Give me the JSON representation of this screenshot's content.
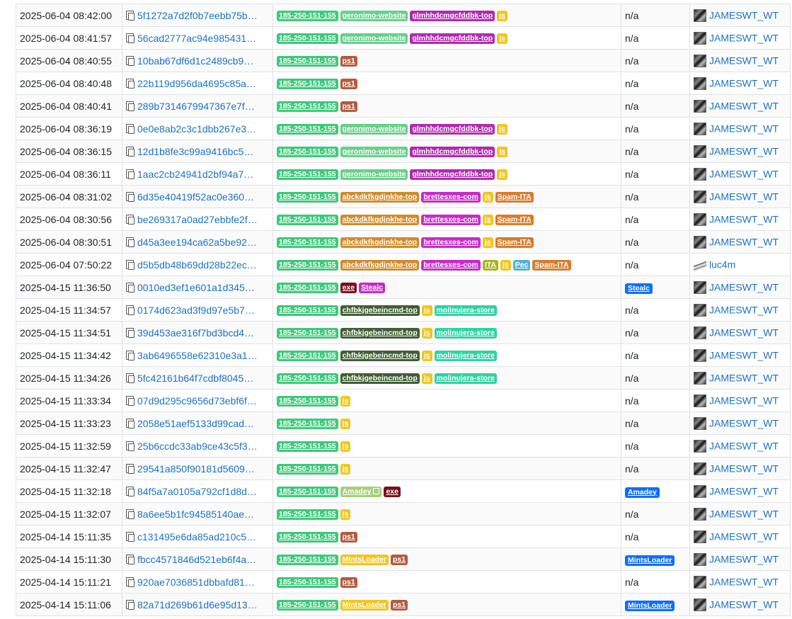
{
  "colors": {
    "185-250-151-155": "#3cc97a",
    "geronimo-website": "#66d089",
    "glmhhdcmgcfddbk-top": "#b02ab0",
    "js": "#f2c51c",
    "ps1": "#b35a3f",
    "abckdkfkgdjnkhe-top": "#d08c2a",
    "brettesxes-com": "#c82ac8",
    "Spam-ITA": "#d97b2a",
    "ITA": "#a8b41c",
    "Pec": "#4cb7d6",
    "exe": "#7a0f1e",
    "Stealc": "#c42ac8",
    "chfbkjgebeincmd-top": "#3f5e34",
    "molinujera-store": "#2fd3a2",
    "Amadey": "#a4d07a",
    "MintsLoader": "#f2c51c"
  },
  "rows": [
    {
      "date": "2025-06-04 08:42:00",
      "hash": "5f1272a7d2f0b7eebb75b…",
      "tags": [
        "185-250-151-155",
        "geronimo-website",
        "glmhhdcmgcfddbk-top",
        "js"
      ],
      "signature": "n/a",
      "reporter": "JAMESWT_WT"
    },
    {
      "date": "2025-06-04 08:41:57",
      "hash": "56cad2777ac94e9854316…",
      "tags": [
        "185-250-151-155",
        "geronimo-website",
        "glmhhdcmgcfddbk-top",
        "js"
      ],
      "signature": "n/a",
      "reporter": "JAMESWT_WT"
    },
    {
      "date": "2025-06-04 08:40:55",
      "hash": "10bab67df6d1c2489cb9…",
      "tags": [
        "185-250-151-155",
        "ps1"
      ],
      "signature": "n/a",
      "reporter": "JAMESWT_WT"
    },
    {
      "date": "2025-06-04 08:40:48",
      "hash": "22b119d956da4695c85a…",
      "tags": [
        "185-250-151-155",
        "ps1"
      ],
      "signature": "n/a",
      "reporter": "JAMESWT_WT"
    },
    {
      "date": "2025-06-04 08:40:41",
      "hash": "289b7314679947367e7fc…",
      "tags": [
        "185-250-151-155",
        "ps1"
      ],
      "signature": "n/a",
      "reporter": "JAMESWT_WT"
    },
    {
      "date": "2025-06-04 08:36:19",
      "hash": "0e0e8ab2c3c1dbb267e3…",
      "tags": [
        "185-250-151-155",
        "geronimo-website",
        "glmhhdcmgcfddbk-top",
        "js"
      ],
      "signature": "n/a",
      "reporter": "JAMESWT_WT"
    },
    {
      "date": "2025-06-04 08:36:15",
      "hash": "12d1b8fe3c99a9416bc53…",
      "tags": [
        "185-250-151-155",
        "geronimo-website",
        "glmhhdcmgcfddbk-top",
        "js"
      ],
      "signature": "n/a",
      "reporter": "JAMESWT_WT"
    },
    {
      "date": "2025-06-04 08:36:11",
      "hash": "1aac2cb24941d2bf94a70…",
      "tags": [
        "185-250-151-155",
        "geronimo-website",
        "glmhhdcmgcfddbk-top",
        "js"
      ],
      "signature": "n/a",
      "reporter": "JAMESWT_WT"
    },
    {
      "date": "2025-06-04 08:31:02",
      "hash": "6d35e40419f52ac0e3603…",
      "tags": [
        "185-250-151-155",
        "abckdkfkgdjnkhe-top",
        "brettesxes-com",
        "js",
        "Spam-ITA"
      ],
      "signature": "n/a",
      "reporter": "JAMESWT_WT"
    },
    {
      "date": "2025-06-04 08:30:56",
      "hash": "be269317a0ad27ebbfe2f…",
      "tags": [
        "185-250-151-155",
        "abckdkfkgdjnkhe-top",
        "brettesxes-com",
        "js",
        "Spam-ITA"
      ],
      "signature": "n/a",
      "reporter": "JAMESWT_WT"
    },
    {
      "date": "2025-06-04 08:30:51",
      "hash": "d45a3ee194ca62a5be92…",
      "tags": [
        "185-250-151-155",
        "abckdkfkgdjnkhe-top",
        "brettesxes-com",
        "js",
        "Spam-ITA"
      ],
      "signature": "n/a",
      "reporter": "JAMESWT_WT"
    },
    {
      "date": "2025-06-04 07:50:22",
      "hash": "d5b5db48b69dd28b22ec…",
      "tags": [
        "185-250-151-155",
        "abckdkfkgdjnkhe-top",
        "brettesxes-com",
        "ITA",
        "js",
        "Pec",
        "Spam-ITA"
      ],
      "signature": "n/a",
      "reporter": "luc4m"
    },
    {
      "date": "2025-04-15 11:36:50",
      "hash": "0010ed3ef1e601a1d3452…",
      "tags": [
        "185-250-151-155",
        "exe",
        "Stealc"
      ],
      "signature": "Stealc",
      "reporter": "JAMESWT_WT"
    },
    {
      "date": "2025-04-15 11:34:57",
      "hash": "0174d623ad3f9d97e5b7…",
      "tags": [
        "185-250-151-155",
        "chfbkjgebeincmd-top",
        "js",
        "molinujera-store"
      ],
      "signature": "n/a",
      "reporter": "JAMESWT_WT"
    },
    {
      "date": "2025-04-15 11:34:51",
      "hash": "39d453ae316f7bd3bcd4…",
      "tags": [
        "185-250-151-155",
        "chfbkjgebeincmd-top",
        "js",
        "molinujera-store"
      ],
      "signature": "n/a",
      "reporter": "JAMESWT_WT"
    },
    {
      "date": "2025-04-15 11:34:42",
      "hash": "3ab6496558e62310e3a1…",
      "tags": [
        "185-250-151-155",
        "chfbkjgebeincmd-top",
        "js",
        "molinujera-store"
      ],
      "signature": "n/a",
      "reporter": "JAMESWT_WT"
    },
    {
      "date": "2025-04-15 11:34:26",
      "hash": "5fc42161b64f7cdbf8045c…",
      "tags": [
        "185-250-151-155",
        "chfbkjgebeincmd-top",
        "js",
        "molinujera-store"
      ],
      "signature": "n/a",
      "reporter": "JAMESWT_WT"
    },
    {
      "date": "2025-04-15 11:33:34",
      "hash": "07d9d295c9656d73ebf6f…",
      "tags": [
        "185-250-151-155",
        "js"
      ],
      "signature": "n/a",
      "reporter": "JAMESWT_WT"
    },
    {
      "date": "2025-04-15 11:33:23",
      "hash": "2058e51aef5133d99cadb…",
      "tags": [
        "185-250-151-155",
        "js"
      ],
      "signature": "n/a",
      "reporter": "JAMESWT_WT"
    },
    {
      "date": "2025-04-15 11:32:59",
      "hash": "25b6ccdc33ab9ce43c5f3…",
      "tags": [
        "185-250-151-155",
        "js"
      ],
      "signature": "n/a",
      "reporter": "JAMESWT_WT"
    },
    {
      "date": "2025-04-15 11:32:47",
      "hash": "29541a850f90181d56099…",
      "tags": [
        "185-250-151-155",
        "js"
      ],
      "signature": "n/a",
      "reporter": "JAMESWT_WT"
    },
    {
      "date": "2025-04-15 11:32:18",
      "hash": "84f5a7a0105a792cf1d8d…",
      "tags": [
        "185-250-151-155",
        "Amadey",
        "exe"
      ],
      "signature": "Amadey",
      "reporter": "JAMESWT_WT"
    },
    {
      "date": "2025-04-15 11:32:07",
      "hash": "8a6ee5b1fc94585140aec…",
      "tags": [
        "185-250-151-155",
        "js"
      ],
      "signature": "n/a",
      "reporter": "JAMESWT_WT"
    },
    {
      "date": "2025-04-14 15:11:35",
      "hash": "c131495e6da85ad210c5…",
      "tags": [
        "185-250-151-155",
        "ps1"
      ],
      "signature": "n/a",
      "reporter": "JAMESWT_WT"
    },
    {
      "date": "2025-04-14 15:11:30",
      "hash": "fbcc4571846d521eb6f4a…",
      "tags": [
        "185-250-151-155",
        "MintsLoader",
        "ps1"
      ],
      "signature": "MintsLoader",
      "reporter": "JAMESWT_WT"
    },
    {
      "date": "2025-04-14 15:11:21",
      "hash": "920ae7036851dbbafd81…",
      "tags": [
        "185-250-151-155",
        "ps1"
      ],
      "signature": "n/a",
      "reporter": "JAMESWT_WT"
    },
    {
      "date": "2025-04-14 15:11:06",
      "hash": "82a71d269b61d6e95d13…",
      "tags": [
        "185-250-151-155",
        "MintsLoader",
        "ps1"
      ],
      "signature": "MintsLoader",
      "reporter": "JAMESWT_WT"
    }
  ]
}
